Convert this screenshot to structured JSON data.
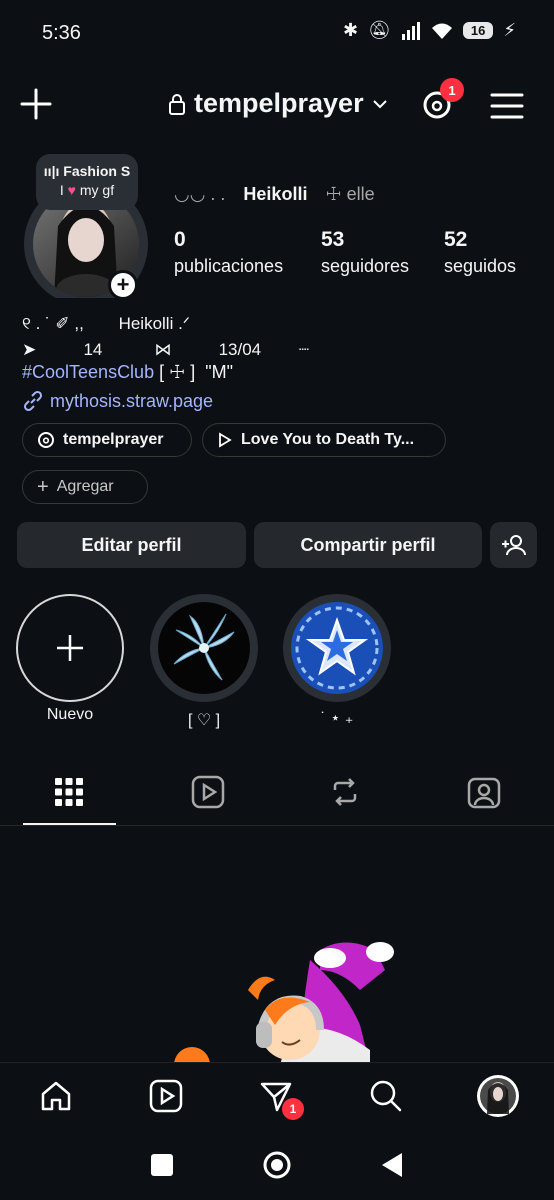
{
  "status_bar": {
    "time": "5:36",
    "battery": "16"
  },
  "top_bar": {
    "username": "tempelprayer",
    "threads_badge": "1"
  },
  "note": {
    "line1": "Fashion S",
    "line2_prefix": "I",
    "line2_suffix": "my gf"
  },
  "profile": {
    "name_deco": "◡◡  .  .",
    "name": "Heikolli",
    "name_suffix": "☩ elle",
    "stats": [
      {
        "value": "0",
        "label": "publicaciones"
      },
      {
        "value": "53",
        "label": "seguidores"
      },
      {
        "value": "52",
        "label": "seguidos"
      }
    ],
    "bio_line1_a": "୧ .     ˙   ✐ ,,",
    "bio_line1_b": "Heikolli .ᐟ",
    "bio_line2": "➤          14           ⋈          13/04        ┈",
    "hashtag": "#CoolTeensClub",
    "hashtag_suffix": " [ ☩ ]  \"M\"",
    "link": "mythosis.straw.page"
  },
  "chips": {
    "threads": "tempelprayer",
    "music": "Love You to Death Ty...",
    "add": "Agregar"
  },
  "buttons": {
    "edit": "Editar perfil",
    "share": "Compartir perfil"
  },
  "highlights": [
    {
      "label": "Nuevo"
    },
    {
      "label": "[ ♡ ]"
    },
    {
      "label": "˙  ⋆ ₊"
    }
  ],
  "nav": {
    "filter_badge": "1"
  }
}
